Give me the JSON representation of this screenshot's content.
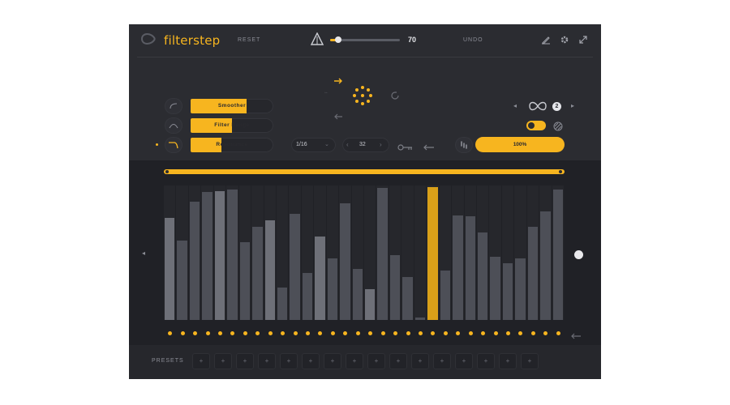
{
  "header": {
    "logo_text": "filterstep",
    "reset_label": "RESET",
    "undo_label": "UNDO",
    "slider_value": "70",
    "icons": [
      "pencil-icon",
      "gear-icon",
      "resize-icon"
    ]
  },
  "controls": {
    "params": [
      {
        "label": "Smoother",
        "level": 0.68
      },
      {
        "label": "Filter Range",
        "level": 0.5
      },
      {
        "label": "Resonance",
        "level": 0.37
      }
    ],
    "rate": "1/16",
    "steps": "32",
    "loop_count": "2",
    "mix_value": "100%"
  },
  "sequencer": {
    "bars": [
      0.76,
      0.59,
      0.88,
      0.95,
      0.96,
      0.97,
      0.58,
      0.69,
      0.74,
      0.24,
      0.79,
      0.35,
      0.62,
      0.46,
      0.87,
      0.38,
      0.23,
      0.98,
      0.48,
      0.32,
      0.02,
      0.99,
      0.37,
      0.78,
      0.77,
      0.65,
      0.47,
      0.42,
      0.46,
      0.69,
      0.81,
      0.97
    ],
    "light_steps": [
      0,
      4,
      8,
      12,
      16
    ],
    "accent_step": 21
  },
  "presets": {
    "label": "PRESETS",
    "slot_symbol": "+",
    "slots": 16
  },
  "colors": {
    "accent": "#f7b51f",
    "panel": "#2b2c31",
    "bar": "#4d4f57"
  }
}
